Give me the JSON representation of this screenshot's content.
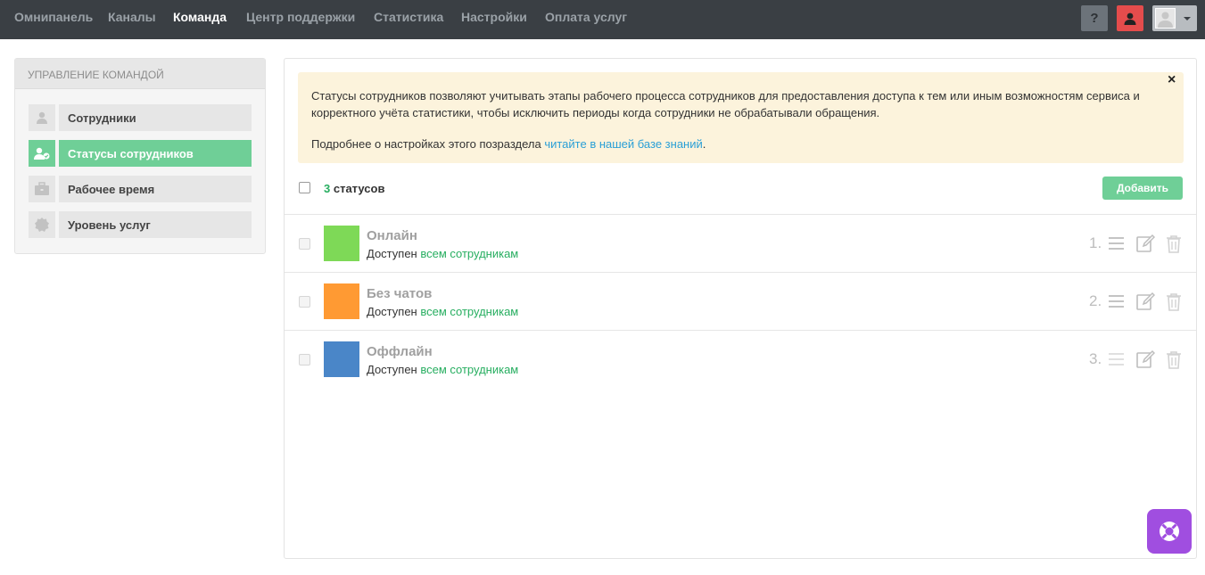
{
  "nav": {
    "items": [
      {
        "label": "Омнипанель",
        "active": false
      },
      {
        "label": "Каналы",
        "active": false
      },
      {
        "label": "Команда",
        "active": true
      },
      {
        "label": "Центр поддержки",
        "active": false
      },
      {
        "label": "Статистика",
        "active": false
      },
      {
        "label": "Настройки",
        "active": false
      },
      {
        "label": "Оплата услуг",
        "active": false
      }
    ],
    "help_label": "?",
    "user_icon": "user-icon",
    "avatar_icon": "avatar-icon"
  },
  "sidebar": {
    "title": "Управление командой",
    "items": [
      {
        "label": "Сотрудники",
        "icon": "user-icon",
        "active": false
      },
      {
        "label": "Статусы сотрудников",
        "icon": "user-status-icon",
        "active": true
      },
      {
        "label": "Рабочее время",
        "icon": "briefcase-icon",
        "active": false
      },
      {
        "label": "Уровень услуг",
        "icon": "badge-icon",
        "active": false
      }
    ]
  },
  "notice": {
    "text": "Статусы сотрудников позволяют учитывать этапы рабочего процесса сотрудников для предоставления доступа к тем или иным возможностям сервиса и корректного учёта статистики, чтобы исключить периоды когда сотрудники не обрабатывали обращения.",
    "more_prefix": "Подробнее о настройках этого позраздела ",
    "more_link": "читайте в нашей базе знаний",
    "more_suffix": ".",
    "close_label": "×"
  },
  "list": {
    "count_number": "3",
    "count_label": " статусов",
    "add_label": "Добавить",
    "rows": [
      {
        "title": "Онлайн",
        "color": "#7ed957",
        "sub_prefix": "Доступен ",
        "sub_link": "всем сотрудникам",
        "num": "1."
      },
      {
        "title": "Без чатов",
        "color": "#ff9a33",
        "sub_prefix": "Доступен ",
        "sub_link": "всем сотрудникам",
        "num": "2."
      },
      {
        "title": "Оффлайн",
        "color": "#4a86c8",
        "sub_prefix": "Доступен ",
        "sub_link": "всем сотрудникам",
        "num": "3."
      }
    ]
  },
  "colors": {
    "accent": "#6fcf97",
    "link_green": "#27ae60",
    "link_blue": "#2a9fd6",
    "fab": "#a04ee0",
    "danger": "#e44c4c"
  }
}
